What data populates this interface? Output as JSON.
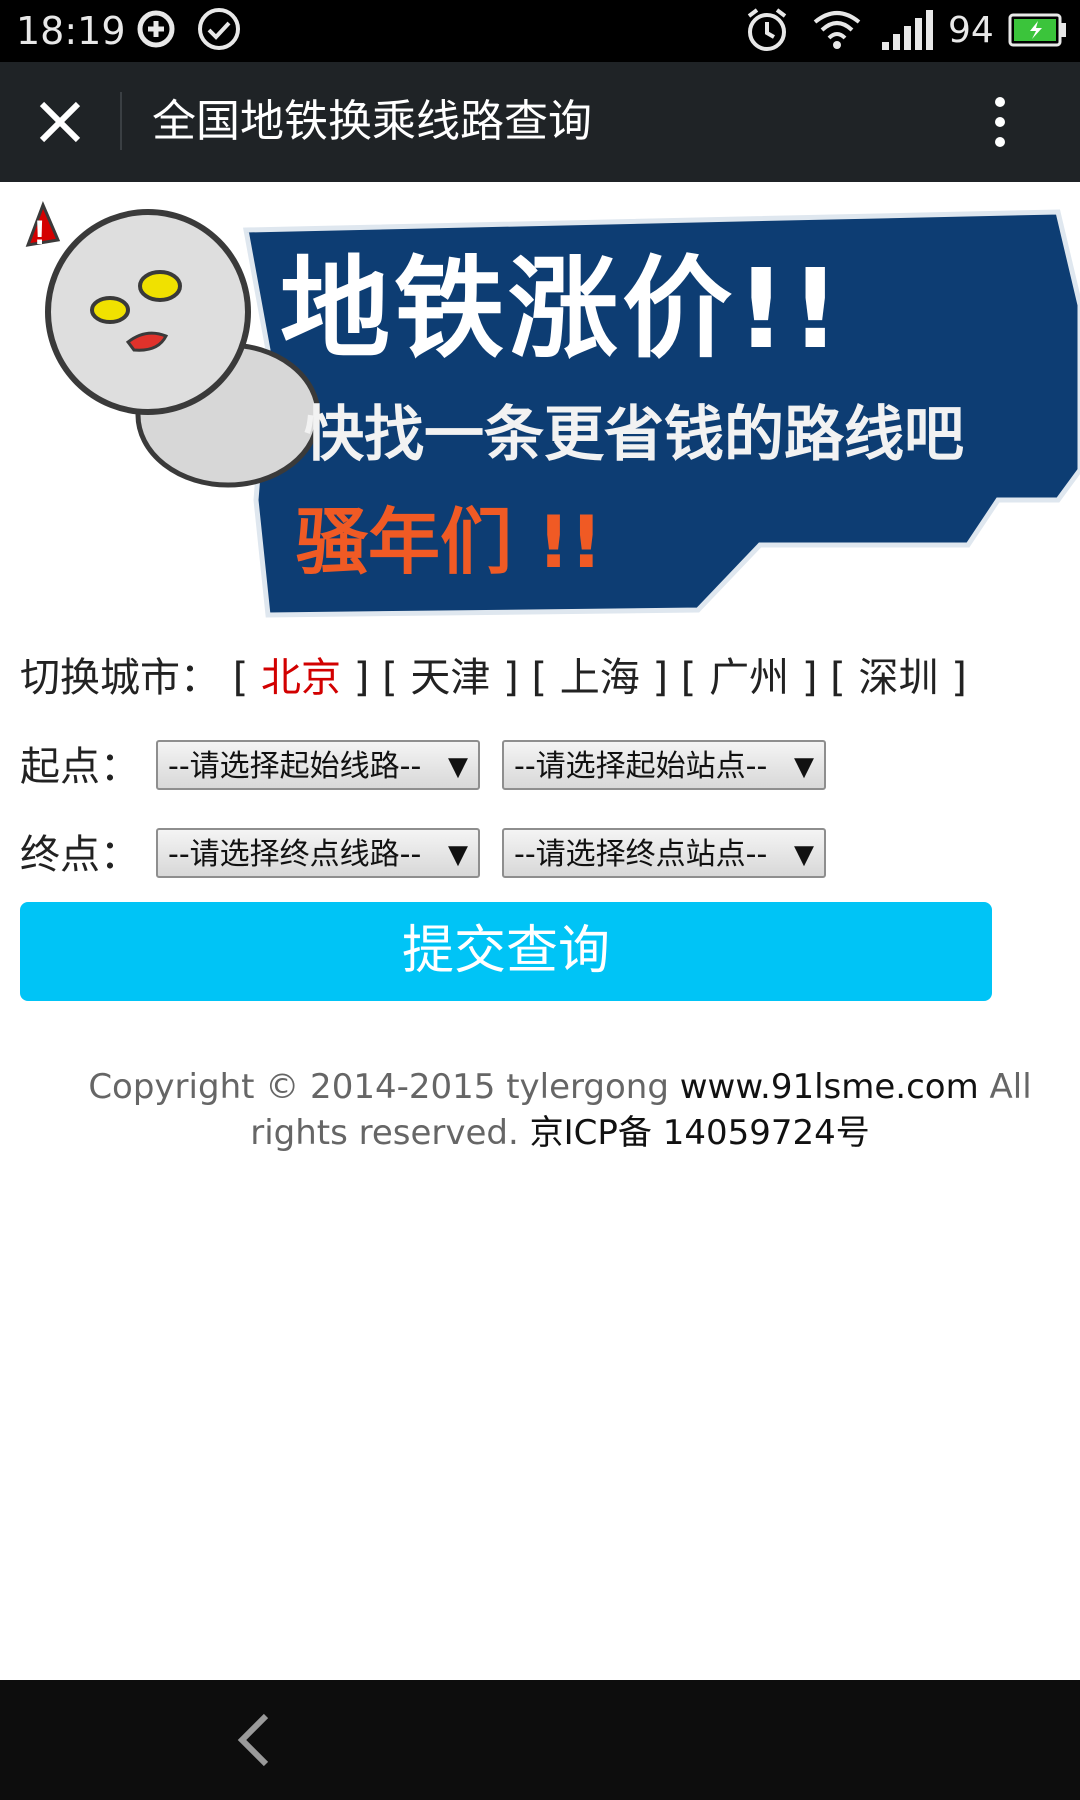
{
  "status_bar": {
    "time": "18:19",
    "battery": "94",
    "icons": [
      "sync-icon",
      "check-circle-icon",
      "alarm-icon",
      "wifi-icon",
      "signal-icon",
      "battery-icon"
    ]
  },
  "app_bar": {
    "title": "全国地铁换乘线路查询",
    "close_icon": "close-icon",
    "menu_icon": "more-vert-icon"
  },
  "banner": {
    "line1": "地铁涨价!!",
    "line2": "快找一条更省钱的路线吧",
    "line3": "骚年们 !!"
  },
  "city_switch": {
    "label": "切换城市：",
    "cities": [
      {
        "name": "北京",
        "active": true
      },
      {
        "name": "天津",
        "active": false
      },
      {
        "name": "上海",
        "active": false
      },
      {
        "name": "广州",
        "active": false
      },
      {
        "name": "深圳",
        "active": false
      }
    ],
    "active_color": "#d20000"
  },
  "form": {
    "start_label": "起点：",
    "end_label": "终点：",
    "start_line_select": "--请选择起始线路--",
    "start_station_select": "--请选择起始站点--",
    "end_line_select": "--请选择终点线路--",
    "end_station_select": "--请选择终点站点--",
    "submit_label": "提交查询",
    "submit_color": "#00c4f6"
  },
  "footer": {
    "copyright": "Copyright © 2014-2015 tylergong",
    "site": "www.91lsme.com",
    "rights": "All rights reserved.",
    "icp": "京ICP备 14059724号"
  },
  "nav_bar": {
    "back_icon": "back-chevron-icon"
  }
}
